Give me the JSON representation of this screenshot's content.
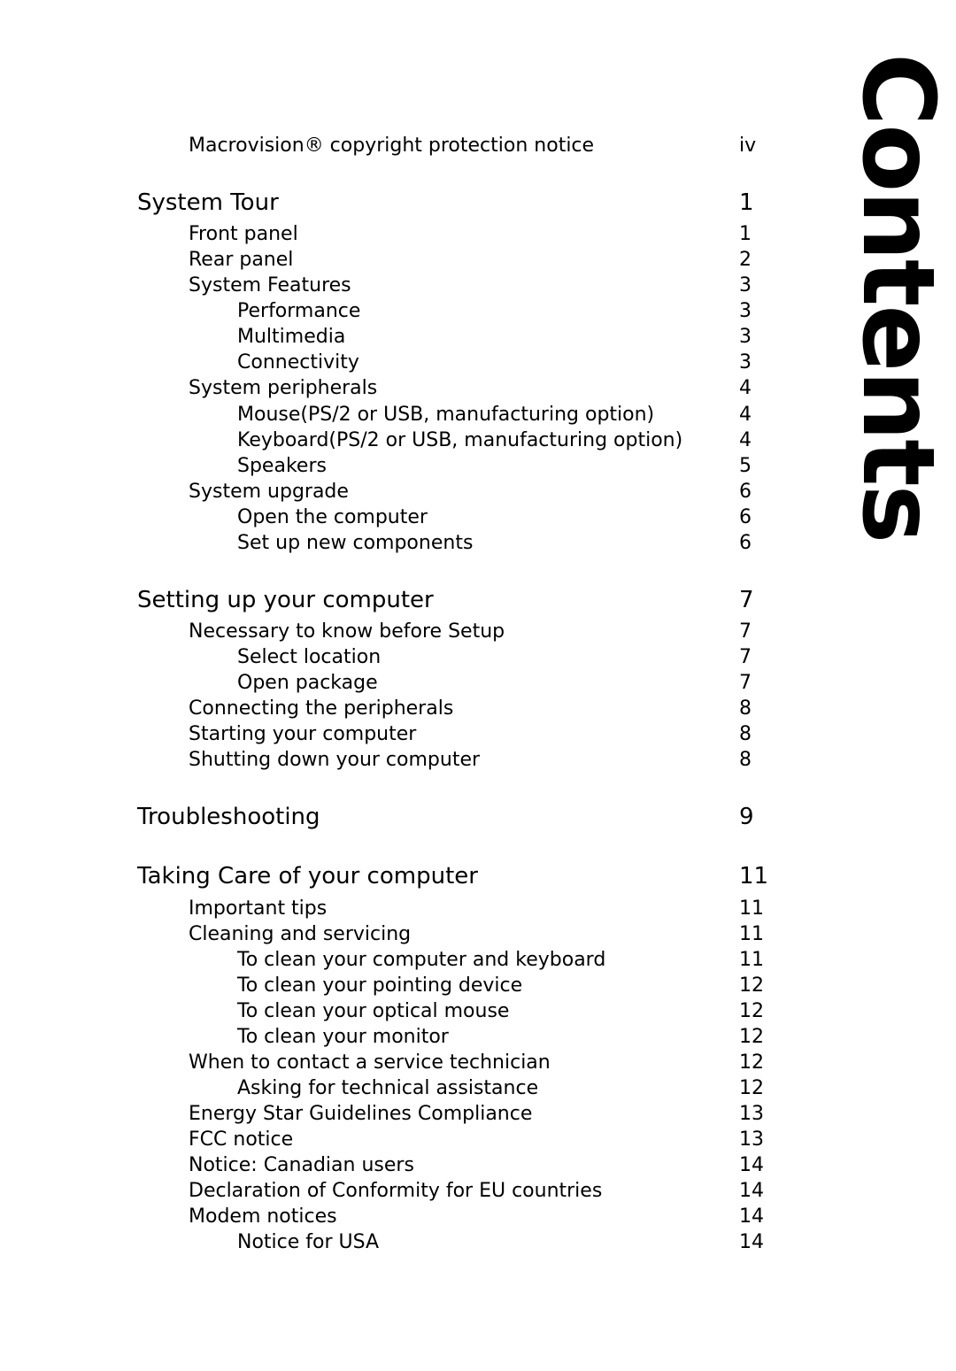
{
  "page": {
    "title_vertical": "Contents"
  },
  "toc": {
    "preamble": [
      {
        "label": "Macrovision® copyright protection notice",
        "page": "iv",
        "level": "pre"
      }
    ],
    "entries": [
      {
        "label": "System Tour",
        "page": "1",
        "level": "top"
      },
      {
        "label": "Front panel",
        "page": "1",
        "level": "1"
      },
      {
        "label": "Rear panel",
        "page": "2",
        "level": "1"
      },
      {
        "label": "System Features",
        "page": "3",
        "level": "1"
      },
      {
        "label": "Performance",
        "page": "3",
        "level": "2"
      },
      {
        "label": "Multimedia",
        "page": "3",
        "level": "2"
      },
      {
        "label": "Connectivity",
        "page": "3",
        "level": "2"
      },
      {
        "label": "System peripherals",
        "page": "4",
        "level": "1"
      },
      {
        "label": "Mouse(PS/2 or USB, manufacturing option)",
        "page": "4",
        "level": "2"
      },
      {
        "label": "Keyboard(PS/2 or USB, manufacturing option)",
        "page": "4",
        "level": "2"
      },
      {
        "label": "Speakers",
        "page": "5",
        "level": "2"
      },
      {
        "label": "System upgrade",
        "page": "6",
        "level": "1"
      },
      {
        "label": "Open the computer",
        "page": "6",
        "level": "2"
      },
      {
        "label": "Set up new components",
        "page": "6",
        "level": "2"
      },
      {
        "label": "Setting up your computer",
        "page": "7",
        "level": "top"
      },
      {
        "label": "Necessary to know before Setup",
        "page": "7",
        "level": "1"
      },
      {
        "label": "Select location",
        "page": "7",
        "level": "2"
      },
      {
        "label": "Open package",
        "page": "7",
        "level": "2"
      },
      {
        "label": "Connecting the peripherals",
        "page": "8",
        "level": "1"
      },
      {
        "label": "Starting your computer",
        "page": "8",
        "level": "1"
      },
      {
        "label": "Shutting down your computer",
        "page": "8",
        "level": "1"
      },
      {
        "label": "Troubleshooting",
        "page": "9",
        "level": "top"
      },
      {
        "label": "Taking Care of your computer",
        "page": "11",
        "level": "top"
      },
      {
        "label": "Important tips",
        "page": "11",
        "level": "1"
      },
      {
        "label": "Cleaning and servicing",
        "page": "11",
        "level": "1"
      },
      {
        "label": "To clean your computer and keyboard",
        "page": "11",
        "level": "2"
      },
      {
        "label": "To clean your pointing device",
        "page": "12",
        "level": "2"
      },
      {
        "label": "To clean your optical mouse",
        "page": "12",
        "level": "2"
      },
      {
        "label": "To clean your monitor",
        "page": "12",
        "level": "2"
      },
      {
        "label": "When to contact a service technician",
        "page": "12",
        "level": "1"
      },
      {
        "label": "Asking for technical assistance",
        "page": "12",
        "level": "2"
      },
      {
        "label": "Energy Star Guidelines Compliance",
        "page": "13",
        "level": "1"
      },
      {
        "label": "FCC notice",
        "page": "13",
        "level": "1"
      },
      {
        "label": "Notice: Canadian users",
        "page": "14",
        "level": "1"
      },
      {
        "label": "Declaration of Conformity for EU countries",
        "page": "14",
        "level": "1"
      },
      {
        "label": "Modem notices",
        "page": "14",
        "level": "1"
      },
      {
        "label": "Notice for USA",
        "page": "14",
        "level": "2"
      }
    ]
  }
}
